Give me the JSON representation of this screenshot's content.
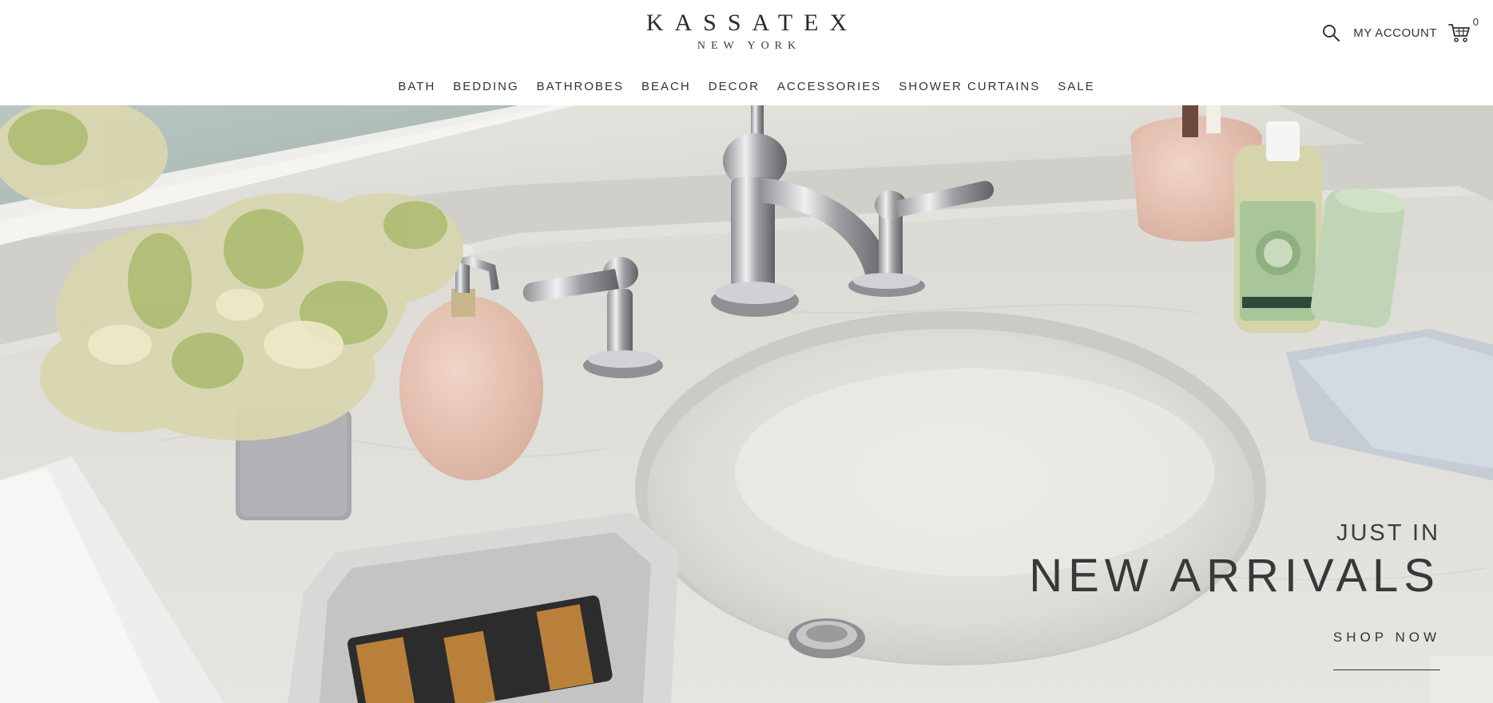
{
  "brand": {
    "name": "KASSATEX",
    "sub": "NEW YORK"
  },
  "header": {
    "account_label": "MY ACCOUNT",
    "cart_count": "0"
  },
  "nav": {
    "items": [
      {
        "label": "BATH"
      },
      {
        "label": "BEDDING"
      },
      {
        "label": "BATHROBES"
      },
      {
        "label": "BEACH"
      },
      {
        "label": "DECOR"
      },
      {
        "label": "ACCESSORIES"
      },
      {
        "label": "SHOWER CURTAINS"
      },
      {
        "label": "SALE"
      }
    ]
  },
  "hero": {
    "eyebrow": "JUST IN",
    "headline": "NEW ARRIVALS",
    "cta": "SHOP NOW"
  },
  "icons": {
    "search": "search-icon",
    "cart": "shopping-cart-icon"
  },
  "colors": {
    "text": "#333333",
    "background": "#ffffff"
  }
}
